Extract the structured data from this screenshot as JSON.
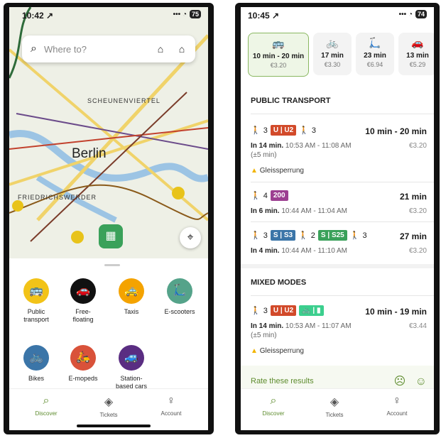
{
  "left": {
    "status": {
      "time": "10:42 ↗",
      "battery": "75",
      "signal": "••• ◔"
    },
    "search": {
      "placeholder": "Where to?"
    },
    "map_labels": {
      "city": "Berlin",
      "district1": "SCHEUNENVIERTEL",
      "district2": "FRIEDRICHSWERDER"
    },
    "modes": [
      {
        "label": "Public\ntransport",
        "color": "#f2c318",
        "icon": "bus-icon",
        "glyph": "🚌"
      },
      {
        "label": "Free-\nfloating",
        "color": "#111111",
        "icon": "car-icon",
        "glyph": "🚗"
      },
      {
        "label": "Taxis",
        "color": "#f4a300",
        "icon": "taxi-icon",
        "glyph": "🚕"
      },
      {
        "label": "E-scooters",
        "color": "#55a38a",
        "icon": "scooter-icon",
        "glyph": "🛴"
      },
      {
        "label": "Bikes",
        "color": "#3b75a8",
        "icon": "bike-icon",
        "glyph": "🚲"
      },
      {
        "label": "E-mopeds",
        "color": "#d9523a",
        "icon": "moped-icon",
        "glyph": "🛵"
      },
      {
        "label": "Station-\nbased cars",
        "color": "#5a2d82",
        "icon": "station-car-icon",
        "glyph": "🚙"
      }
    ],
    "tabs": [
      {
        "label": "Discover",
        "icon": "search-icon",
        "glyph": "⌕"
      },
      {
        "label": "Tickets",
        "icon": "ticket-icon",
        "glyph": "◈"
      },
      {
        "label": "Account",
        "icon": "account-icon",
        "glyph": "♀"
      }
    ]
  },
  "right": {
    "status": {
      "time": "10:45 ↗",
      "battery": "74",
      "signal": "••• ◔"
    },
    "mode_cards": [
      {
        "icon": "bus-icon",
        "glyph": "🚌",
        "time": "10 min - 20 min",
        "price": "€3.20",
        "selected": true
      },
      {
        "icon": "bike-icon",
        "glyph": "🚲",
        "time": "17 min",
        "price": "€3.30"
      },
      {
        "icon": "scooter-icon",
        "glyph": "🛴",
        "time": "23 min",
        "price": "€6.94"
      },
      {
        "icon": "car-icon",
        "glyph": "🚗",
        "time": "13 min",
        "price": "€5.29"
      }
    ],
    "public_transport": {
      "heading": "PUBLIC TRANSPORT",
      "routes": [
        {
          "walk1": "3",
          "line": "U | U2",
          "walk2": "3",
          "duration": "10 min - 20 min",
          "price": "€3.20",
          "depart": "In 14 min.",
          "times": "10:53 AM - 11:08 AM (±5 min)",
          "alert": "Gleissperrung"
        },
        {
          "walk1": "4",
          "line": "200",
          "duration": "21 min",
          "price": "€3.20",
          "depart": "In 6 min.",
          "times": "10:44 AM - 11:04 AM"
        },
        {
          "walk1": "3",
          "line": "S | S3",
          "walk2": "2",
          "line2": "S | S25",
          "walk3": "3",
          "duration": "27 min",
          "price": "€3.20",
          "depart": "In 4 min.",
          "times": "10:44 AM - 11:10 AM"
        }
      ]
    },
    "mixed_modes": {
      "heading": "MIXED MODES",
      "route": {
        "walk1": "3",
        "line": "U | U2",
        "bike": "🚲 | ▮",
        "duration": "10 min - 19 min",
        "price": "€3.44",
        "depart": "In 14 min.",
        "times": "10:53 AM - 11:07 AM (±5 min)",
        "alert": "Gleissperrung"
      }
    },
    "rate": {
      "label": "Rate these results",
      "down": "☹",
      "up": "☺"
    },
    "tabs": [
      {
        "label": "Discover",
        "icon": "search-icon",
        "glyph": "⌕"
      },
      {
        "label": "Tickets",
        "icon": "ticket-icon",
        "glyph": "◈"
      },
      {
        "label": "Account",
        "icon": "account-icon",
        "glyph": "♀"
      }
    ]
  }
}
